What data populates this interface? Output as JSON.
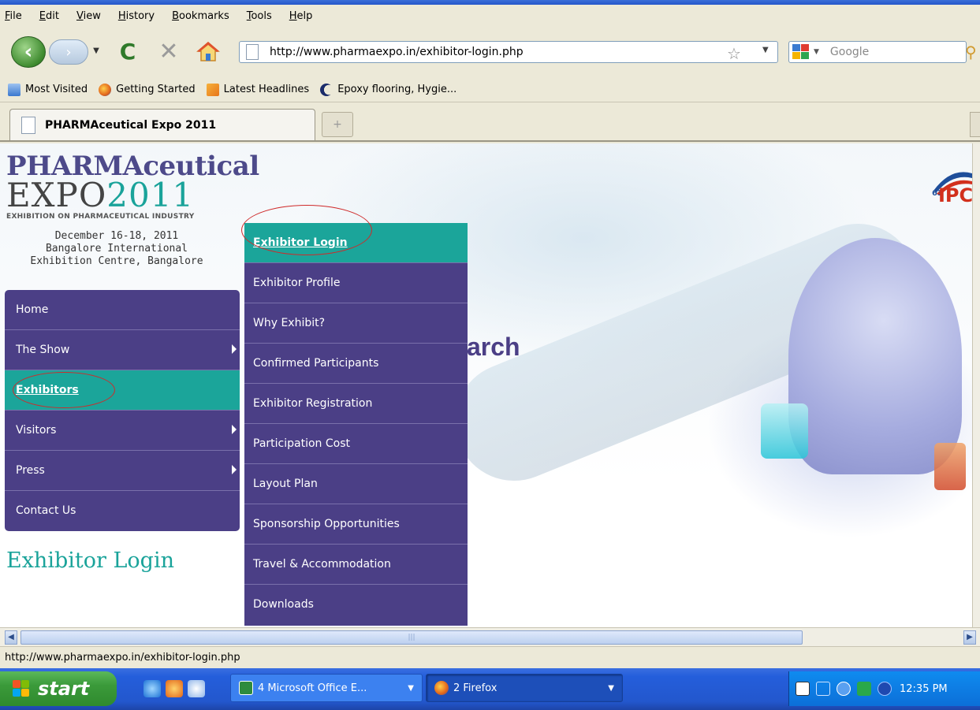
{
  "menubar": {
    "items": [
      "File",
      "Edit",
      "View",
      "History",
      "Bookmarks",
      "Tools",
      "Help"
    ]
  },
  "toolbar": {
    "url": "http://www.pharmaexpo.in/exhibitor-login.php",
    "search_placeholder": "Google",
    "icons": {
      "back": "back-arrow-icon",
      "forward": "forward-arrow-icon",
      "reload": "reload-icon",
      "stop": "stop-icon",
      "home": "home-icon",
      "bookmark": "star-icon",
      "search_go": "magnifier-icon"
    }
  },
  "bookmarks": [
    "Most Visited",
    "Getting Started",
    "Latest Headlines",
    "Epoxy flooring, Hygie..."
  ],
  "tabs": {
    "active_title": "PHARMAceutical Expo 2011",
    "new_tab_symbol": "+"
  },
  "site": {
    "logo": {
      "line1": "PHARMAceutical",
      "line2_word": "EXPO",
      "line2_year": "2011",
      "tagline": "EXHIBITION ON PHARMACEUTICAL INDUSTRY"
    },
    "event_dates": "December 16-18, 2011",
    "venue_line1": "Bangalore International",
    "venue_line2": "Exhibition Centre, Bangalore",
    "partner_logo": {
      "prefix": "63",
      "text": "IPC"
    },
    "hero_word": "arch",
    "page_heading": "Exhibitor Login"
  },
  "leftnav": [
    {
      "label": "Home",
      "has_submenu": false,
      "active": false
    },
    {
      "label": "The Show",
      "has_submenu": true,
      "active": false
    },
    {
      "label": "Exhibitors",
      "has_submenu": false,
      "active": true
    },
    {
      "label": "Visitors",
      "has_submenu": true,
      "active": false
    },
    {
      "label": "Press",
      "has_submenu": true,
      "active": false
    },
    {
      "label": "Contact Us",
      "has_submenu": false,
      "active": false
    }
  ],
  "submenu": [
    {
      "label": "Exhibitor Login",
      "active": true
    },
    {
      "label": "Exhibitor Profile",
      "active": false
    },
    {
      "label": "Why Exhibit?",
      "active": false
    },
    {
      "label": "Confirmed Participants",
      "active": false
    },
    {
      "label": "Exhibitor Registration",
      "active": false
    },
    {
      "label": "Participation Cost",
      "active": false
    },
    {
      "label": "Layout Plan",
      "active": false
    },
    {
      "label": "Sponsorship Opportunities",
      "active": false
    },
    {
      "label": "Travel & Accommodation",
      "active": false
    },
    {
      "label": "Downloads",
      "active": false
    }
  ],
  "statusbar": {
    "text": "http://www.pharmaexpo.in/exhibitor-login.php"
  },
  "taskbar": {
    "start_label": "start",
    "tasks": [
      {
        "label": "4 Microsoft Office E...",
        "active": false
      },
      {
        "label": "2 Firefox",
        "active": true
      }
    ],
    "clock": "12:35 PM"
  },
  "colors": {
    "nav_purple": "#4b3f86",
    "nav_teal_active": "#1ba59a",
    "annotation_red": "#cf2a2a",
    "taskbar_blue": "#245edb"
  }
}
